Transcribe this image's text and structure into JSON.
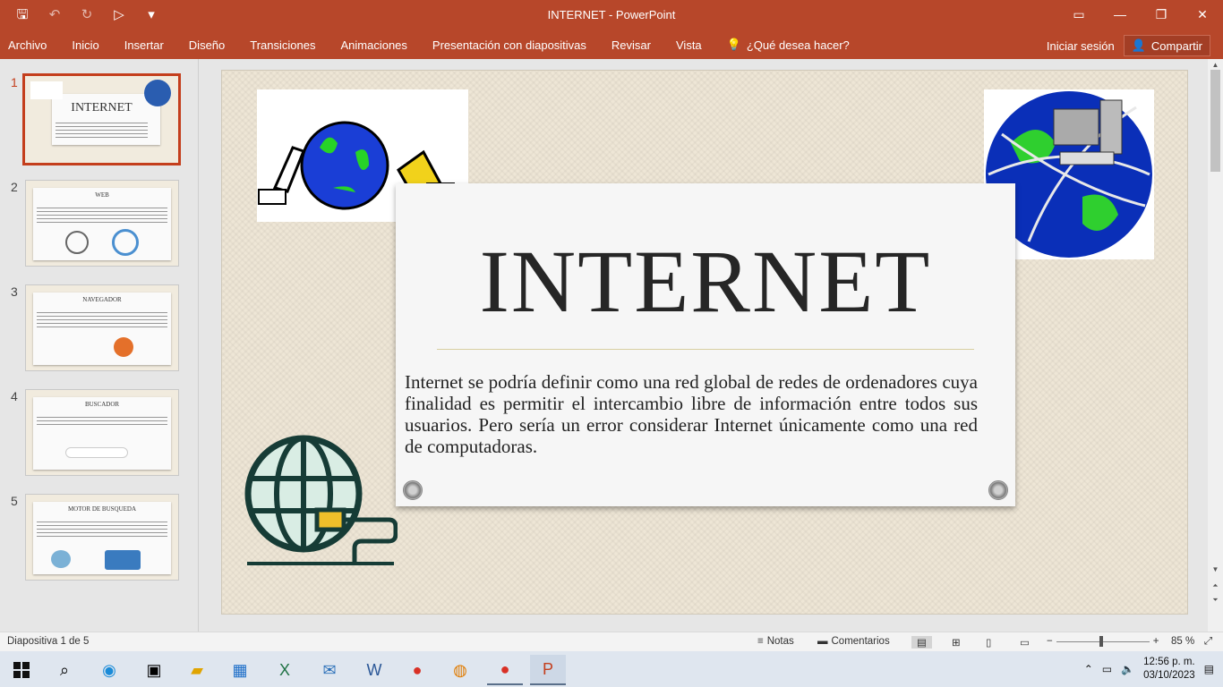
{
  "app": {
    "title": "INTERNET - PowerPoint"
  },
  "qat": {
    "save": "🖫",
    "undo": "↶",
    "redo": "↻",
    "present": "▷",
    "more": "▾"
  },
  "window": {
    "restore_ribbon": "▭",
    "minimize": "—",
    "maximize": "❐",
    "close": "✕"
  },
  "ribbon": {
    "tabs": [
      "Archivo",
      "Inicio",
      "Insertar",
      "Diseño",
      "Transiciones",
      "Animaciones",
      "Presentación con diapositivas",
      "Revisar",
      "Vista"
    ],
    "tell_me": "¿Qué desea hacer?",
    "sign_in": "Iniciar sesión",
    "share": "Compartir"
  },
  "thumbnails": [
    {
      "num": "1",
      "title": "INTERNET"
    },
    {
      "num": "2",
      "title": "WEB"
    },
    {
      "num": "3",
      "title": "NAVEGADOR"
    },
    {
      "num": "4",
      "title": "BUSCADOR"
    },
    {
      "num": "5",
      "title": "MOTOR DE BUSQUEDA"
    }
  ],
  "slide": {
    "title": "INTERNET",
    "body": "Internet se podría definir como una red global de redes de ordenadores cuya finalidad es permitir el intercambio libre de información entre todos sus usuarios. Pero sería un error considerar Internet únicamente como una red de computadoras."
  },
  "status": {
    "slide_info": "Diapositiva 1 de 5",
    "notes": "Notas",
    "comments": "Comentarios",
    "zoom": "85 %"
  },
  "taskbar": {
    "time": "12:56 p. m.",
    "date": "03/10/2023"
  },
  "colors": {
    "accent": "#b7472a",
    "selected": "#c43e1c"
  }
}
